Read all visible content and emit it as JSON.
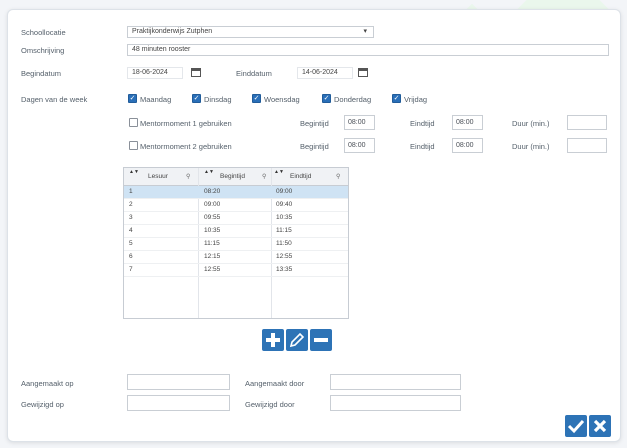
{
  "form": {
    "schoollocatie": {
      "label": "Schoollocatie",
      "value": "Praktijkonderwijs Zutphen"
    },
    "omschrijving": {
      "label": "Omschrijving",
      "value": "48 minuten rooster"
    },
    "begindatum": {
      "label": "Begindatum",
      "value": "18-06-2024"
    },
    "einddatum": {
      "label": "Einddatum",
      "value": "14-06-2024"
    },
    "dagen": {
      "label": "Dagen van de week",
      "items": [
        {
          "label": "Maandag",
          "checked": true
        },
        {
          "label": "Dinsdag",
          "checked": true
        },
        {
          "label": "Woensdag",
          "checked": true
        },
        {
          "label": "Donderdag",
          "checked": true
        },
        {
          "label": "Vrijdag",
          "checked": true
        }
      ]
    },
    "pauze1": {
      "label": "Mentormoment 1 gebruiken",
      "begintijd_label": "Begintijd",
      "begintijd": "08:00",
      "eindtijd_label": "Eindtijd",
      "eindtijd": "08:00",
      "duur_label": "Duur (min.)",
      "duur": ""
    },
    "pauze2": {
      "label": "Mentormoment 2 gebruiken",
      "begintijd_label": "Begintijd",
      "begintijd": "08:00",
      "eindtijd_label": "Eindtijd",
      "eindtijd": "08:00",
      "duur_label": "Duur (min.)",
      "duur": ""
    }
  },
  "grid": {
    "columns": [
      "Lesuur",
      "Begintijd",
      "Eindtijd"
    ],
    "rows": [
      {
        "lesuur": "1",
        "begin": "08:20",
        "eind": "09:00"
      },
      {
        "lesuur": "2",
        "begin": "09:00",
        "eind": "09:40"
      },
      {
        "lesuur": "3",
        "begin": "09:55",
        "eind": "10:35"
      },
      {
        "lesuur": "4",
        "begin": "10:35",
        "eind": "11:15"
      },
      {
        "lesuur": "5",
        "begin": "11:15",
        "eind": "11:50"
      },
      {
        "lesuur": "6",
        "begin": "12:15",
        "eind": "12:55"
      },
      {
        "lesuur": "7",
        "begin": "12:55",
        "eind": "13:35"
      }
    ]
  },
  "audit": {
    "aangemaakt_op": "Aangemaakt op",
    "aangemaakt_door": "Aangemaakt door",
    "gewijzigd_op": "Gewijzigd op",
    "gewijzigd_door": "Gewijzigd door"
  },
  "colors": {
    "accent": "#2d73b6",
    "selected_row": "#cfe3f4",
    "checkbox": "#2a6fb8"
  },
  "icons": [
    "calendar-icon",
    "add-icon",
    "edit-icon",
    "remove-icon",
    "confirm-icon",
    "cancel-icon",
    "chevron-down-icon",
    "sort-icon",
    "filter-icon"
  ]
}
